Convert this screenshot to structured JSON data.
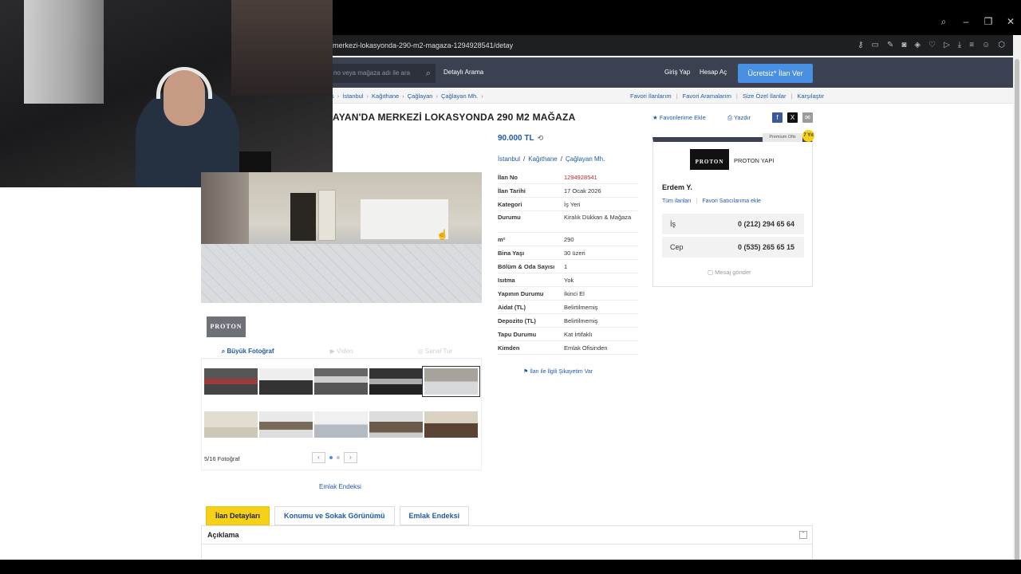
{
  "browser": {
    "url": "merkezi-lokasyonda-290-m2-magaza-1294928541/detay",
    "window_controls": [
      "search",
      "minimize",
      "restore",
      "close"
    ]
  },
  "header": {
    "search_placeholder": "no veya mağaza adı ile ara",
    "detailed_search": "Detaylı Arama",
    "login": "Giriş Yap",
    "register": "Hesap Aç",
    "post_ad": "Ücretsiz* İlan Ver"
  },
  "breadcrumb": {
    "items": [
      "s",
      "İstanbul",
      "Kağıthane",
      "Çağlayan",
      "Çağlayan Mh."
    ],
    "links": [
      "Favori İlanlarım",
      "Favori Aramalarım",
      "Size Özel İlanlar",
      "Karşılaştır"
    ]
  },
  "listing": {
    "title": "AYAN'DA MERKEZİ LOKASYONDA 290 M2 MAĞAZA",
    "favorite": "Favorilerime Ekle",
    "print": "Yazdır",
    "price": "90.000 TL",
    "location": [
      "İstanbul",
      "Kağıthane",
      "Çağlayan Mh."
    ],
    "details": [
      {
        "key": "İlan No",
        "value": "1294928541"
      },
      {
        "key": "İlan Tarihi",
        "value": "17 Ocak 2026"
      },
      {
        "key": "Kategori",
        "value": "İş Yeri"
      },
      {
        "key": "Durumu",
        "value": "Kiralık Dükkan & Mağaza"
      },
      {
        "key": "m²",
        "value": "290"
      },
      {
        "key": "Bina Yaşı",
        "value": "30 üzeri"
      },
      {
        "key": "Bölüm & Oda Sayısı",
        "value": "1"
      },
      {
        "key": "Isıtma",
        "value": "Yok"
      },
      {
        "key": "Yapının Durumu",
        "value": "İkinci El"
      },
      {
        "key": "Aidat (TL)",
        "value": "Belirtilmemiş"
      },
      {
        "key": "Depozito (TL)",
        "value": "Belirtilmemiş"
      },
      {
        "key": "Tapu Durumu",
        "value": "Kat İrtifaklı"
      },
      {
        "key": "Kimden",
        "value": "Emlak Ofisinden"
      }
    ],
    "complaint": "İlan ile İlgili Şikayetim Var"
  },
  "gallery": {
    "logo_text": "PROTON",
    "tabs": [
      "Büyük Fotoğraf",
      "Video",
      "Sanal Tur"
    ],
    "photo_count": "5/16 Fotoğraf",
    "emlak_endeksi": "Emlak Endeksi"
  },
  "seller": {
    "premium": "Premium Ofis",
    "badge": "7 Yıl",
    "logo_text": "PROTON",
    "company": "PROTON YAPI",
    "name": "Erdem Y.",
    "all_ads": "Tüm ilanları",
    "add_favorite": "Favori Satıcılarıma ekle",
    "phones": [
      {
        "label": "İş",
        "number": "0 (212) 294 65 64"
      },
      {
        "label": "Cep",
        "number": "0 (535) 265 65 15"
      }
    ],
    "message": "Mesaj gönder"
  },
  "bottom_tabs": [
    "İlan Detayları",
    "Konumu ve Sokak Görünümü",
    "Emlak Endeksi"
  ],
  "description": {
    "title": "Açıklama"
  },
  "colors": {
    "header": "#3b4150",
    "accent": "#4a90e2",
    "link": "#1f5aa6",
    "active_tab": "#f7d117"
  }
}
